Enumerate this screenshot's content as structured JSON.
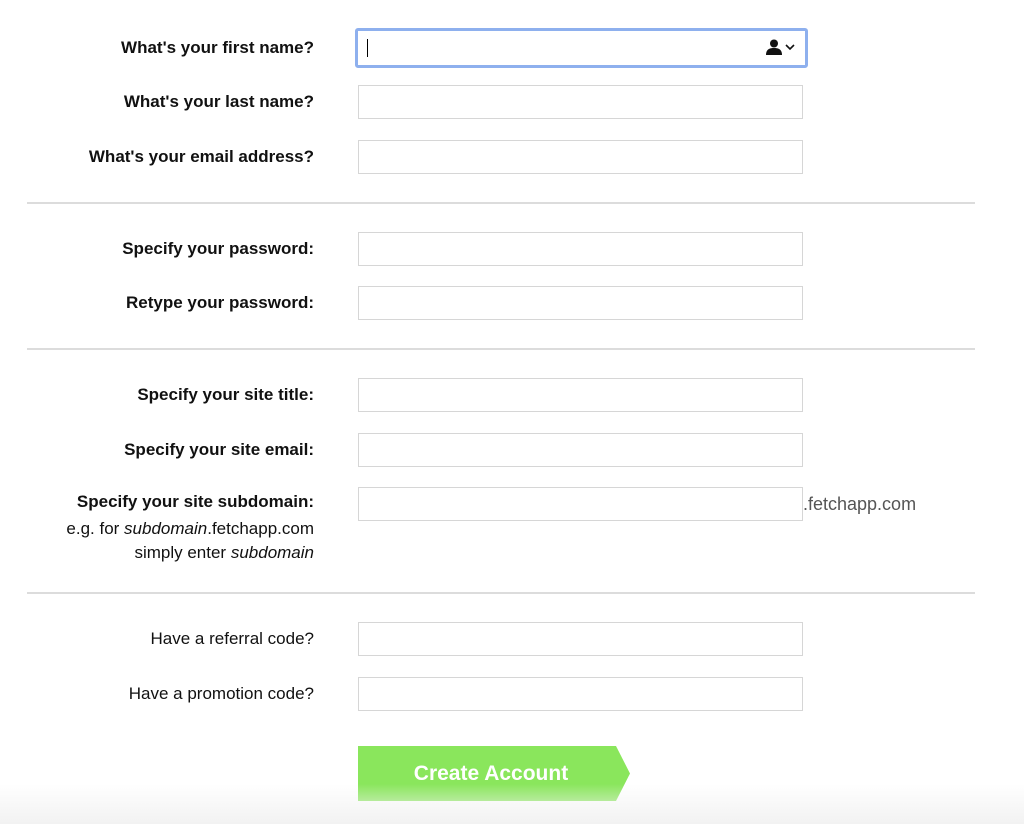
{
  "form": {
    "personal": {
      "first_name_label": "What's your first name?",
      "first_name_value": "",
      "last_name_label": "What's your last name?",
      "last_name_value": "",
      "email_label": "What's your email address?",
      "email_value": ""
    },
    "password": {
      "password_label": "Specify your password:",
      "retype_label": "Retype your password:"
    },
    "site": {
      "title_label": "Specify your site title:",
      "email_label": "Specify your site email:",
      "subdomain_label": "Specify your site subdomain:",
      "hint_line1_prefix": "e.g. for ",
      "hint_line1_em": "subdomain",
      "hint_line1_suffix": ".fetchapp.com",
      "hint_line2_prefix": "simply enter ",
      "hint_line2_em": "subdomain",
      "subdomain_suffix": ".fetchapp.com"
    },
    "codes": {
      "referral_label": "Have a referral code?",
      "promotion_label": "Have a promotion code?"
    },
    "submit_label": "Create Account"
  },
  "icons": {
    "autofill": "contact-autofill-icon",
    "dropdown": "chevron-down-icon"
  },
  "colors": {
    "button": "#8ae65c",
    "focus_ring": "#8eb0ee",
    "suffix_text": "#555555"
  }
}
